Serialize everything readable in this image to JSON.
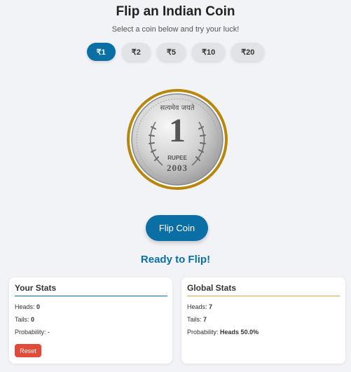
{
  "header": {
    "title": "Flip an Indian Coin",
    "subtitle": "Select a coin below and try your luck!"
  },
  "coins": [
    {
      "label": "₹1",
      "selected": true
    },
    {
      "label": "₹2",
      "selected": false
    },
    {
      "label": "₹5",
      "selected": false
    },
    {
      "label": "₹10",
      "selected": false
    },
    {
      "label": "₹20",
      "selected": false
    }
  ],
  "coin_face": {
    "top_text": "सत्यमेव जयते",
    "denomination": "1",
    "unit": "RUPEE",
    "year": "2003"
  },
  "flip_button": "Flip Coin",
  "status": "Ready to Flip!",
  "your_stats": {
    "title": "Your Stats",
    "heads_label": "Heads:",
    "heads": "0",
    "tails_label": "Tails:",
    "tails": "0",
    "probability_label": "Probability:",
    "probability": "-",
    "reset": "Reset"
  },
  "global_stats": {
    "title": "Global Stats",
    "heads_label": "Heads:",
    "heads": "7",
    "tails_label": "Tails:",
    "tails": "7",
    "probability_label": "Probability:",
    "probability": "Heads 50.0%"
  },
  "colors": {
    "accent": "#0a6fa5",
    "reset": "#e04b3a",
    "global_rule": "#e0a24a",
    "coin_rim": "#b8860b"
  }
}
